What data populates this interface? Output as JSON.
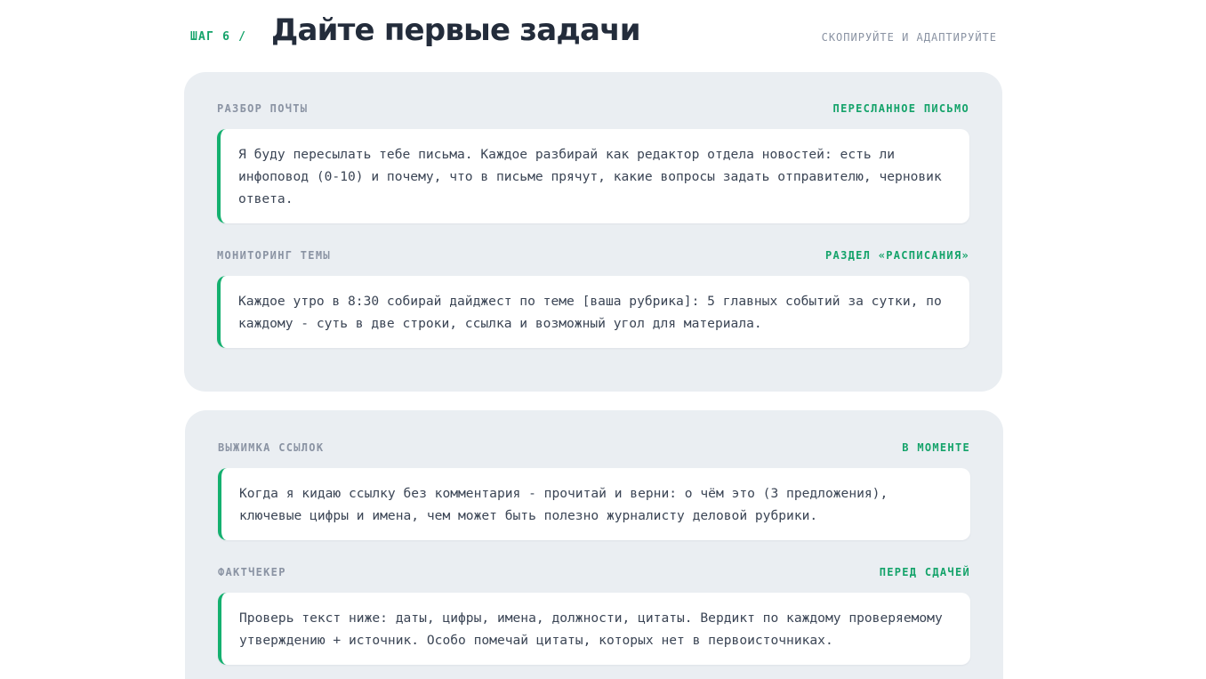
{
  "header": {
    "step_label": "ШАГ 6 /",
    "title": "Дайте первые задачи",
    "hint": "СКОПИРУЙТЕ И АДАПТИРУЙТЕ"
  },
  "panels": [
    {
      "tasks": [
        {
          "title": "РАЗБОР ПОЧТЫ",
          "tag": "ПЕРЕСЛАННОЕ ПИСЬМО",
          "prompt": "Я буду пересылать тебе письма. Каждое разбирай как редактор отдела новостей: есть ли инфоповод (0-10) и почему, что в письме прячут, какие вопросы задать отправителю, черновик ответа."
        },
        {
          "title": "МОНИТОРИНГ ТЕМЫ",
          "tag": "РАЗДЕЛ «РАСПИСАНИЯ»",
          "prompt": "Каждое утро в 8:30 собирай дайджест по теме [ваша рубрика]: 5 главных событий за сутки, по каждому - суть в две строки, ссылка и возможный угол для материала."
        }
      ]
    },
    {
      "tasks": [
        {
          "title": "ВЫЖИМКА ССЫЛОК",
          "tag": "В МОМЕНТЕ",
          "prompt": "Когда я кидаю ссылку без комментария - прочитай и верни: о чём это (3 предложения), ключевые цифры и имена, чем может быть полезно журналисту деловой рубрики."
        },
        {
          "title": "ФАКТЧЕКЕР",
          "tag": "ПЕРЕД СДАЧЕЙ",
          "prompt": "Проверь текст ниже: даты, цифры, имена, должности, цитаты. Вердикт по каждому проверяемому утверждению + источник. Особо помечай цитаты, которых нет в первоисточниках."
        }
      ]
    }
  ],
  "colors": {
    "accent": "#14a36a",
    "accent_border": "#14b06f",
    "panel_bg": "#eaeef2",
    "title_text": "#232c3b",
    "muted_text": "#8a93a3"
  }
}
